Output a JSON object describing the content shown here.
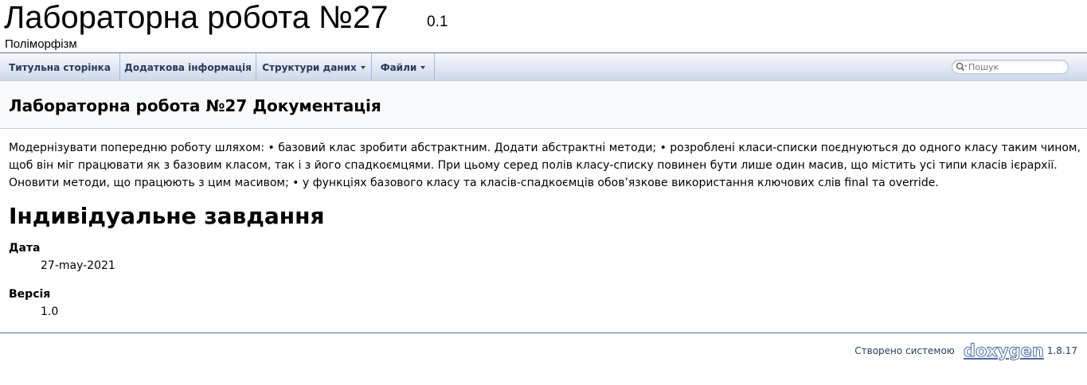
{
  "project": {
    "name": "Лабораторна робота №27",
    "number": "0.1",
    "brief": "Поліморфізм"
  },
  "nav": {
    "items": [
      {
        "label": "Титульна сторінка",
        "dropdown": false
      },
      {
        "label": "Додаткова інформація",
        "dropdown": false
      },
      {
        "label": "Структури даних",
        "dropdown": true
      },
      {
        "label": "Файли",
        "dropdown": true
      }
    ],
    "search_placeholder": "Пошук"
  },
  "header": {
    "title": "Лабораторна робота №27 Документація"
  },
  "content": {
    "description": "Модернізувати попередню роботу шляхом: • базовий клас зробити абстрактним. Додати абстрактні методи; • розроблені класи-списки поєднуються до одного класу таким чином, щоб він міг працювати як з базовим класом, так і з його спадкоємцями. При цьому серед полів класу-списку повинен бути лише один масив, що містить усі типи класів ієрархії. Оновити методи, що працюють з цим масивом; • у функціях базового класу та класів-спадкоємців обов’язкове використання ключових слів final та override.",
    "section_title": "Індивідуальне завдання",
    "date_label": "Дата",
    "date_value": "27-may-2021",
    "version_label": "Версія",
    "version_value": "1.0"
  },
  "footer": {
    "generated_by": "Створено системою",
    "logo_text": "doxygen",
    "version": "1.8.17"
  },
  "colors": {
    "nav_text": "#283a5d",
    "nav_border": "#5b72a6",
    "footer_text": "#2a3d61"
  },
  "icons": {
    "search": "magnifier-icon",
    "dropdown": "caret-down-icon"
  }
}
